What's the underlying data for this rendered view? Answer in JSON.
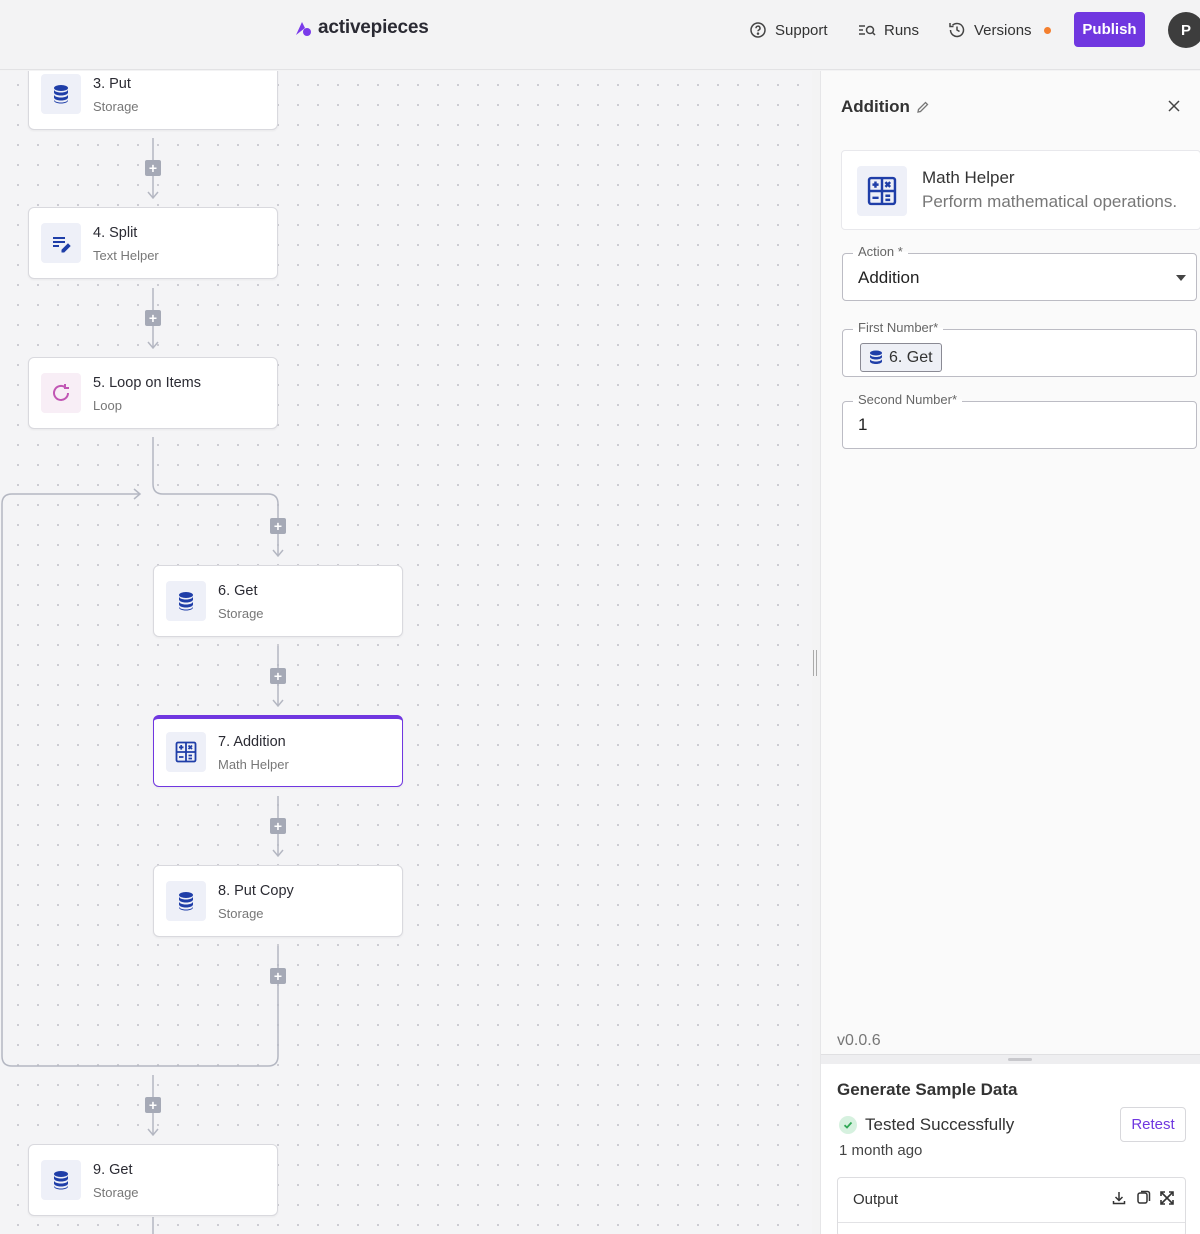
{
  "header": {
    "logo": "activepieces",
    "support": "Support",
    "runs": "Runs",
    "versions": "Versions",
    "publish": "Publish",
    "avatar": "P"
  },
  "steps": [
    {
      "title": "3. Put",
      "subtitle": "Storage",
      "icon": "database-icon"
    },
    {
      "title": "4. Split",
      "subtitle": "Text Helper",
      "icon": "text-edit-icon"
    },
    {
      "title": "5. Loop on Items",
      "subtitle": "Loop",
      "icon": "loop-icon"
    },
    {
      "title": "6. Get",
      "subtitle": "Storage",
      "icon": "database-icon"
    },
    {
      "title": "7. Addition",
      "subtitle": "Math Helper",
      "icon": "calculator-icon",
      "selected": true
    },
    {
      "title": "8. Put Copy",
      "subtitle": "Storage",
      "icon": "database-icon"
    },
    {
      "title": "9. Get",
      "subtitle": "Storage",
      "icon": "database-icon"
    }
  ],
  "panel": {
    "title": "Addition",
    "piece_name": "Math Helper",
    "piece_description": "Perform mathematical operations.",
    "action_label": "Action *",
    "action_value": "Addition",
    "first_number_label": "First Number*",
    "first_number_chip": "6. Get",
    "second_number_label": "Second Number*",
    "second_number_value": "1",
    "version": "v0.0.6"
  },
  "sample": {
    "title": "Generate Sample Data",
    "status": "Tested Successfully",
    "ago": "1 month ago",
    "retest": "Retest",
    "output_label": "Output"
  },
  "colors": {
    "accent": "#7037e0",
    "step_icon": "#1f3ea8",
    "loop_icon": "#c156b4",
    "success": "#2fa855",
    "versions_dot": "#f47f2e"
  }
}
